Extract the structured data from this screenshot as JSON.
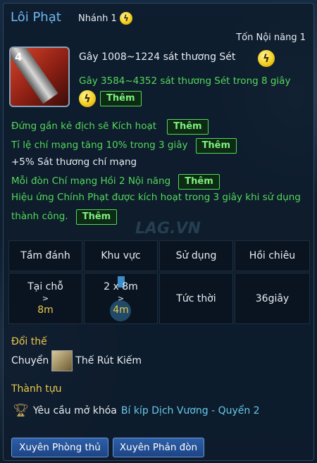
{
  "header": {
    "title": "Lôi Phạt",
    "branch": "Nhánh 1",
    "cost": "Tốn Nội năng 1"
  },
  "skill": {
    "level": "4",
    "damage_line1": "Gây 1008~1224 sát thương Sét",
    "damage_line2": "Gây 3584~4352 sát thương Sét trong 8 giây"
  },
  "effects": {
    "more_label": "Thêm",
    "line1": "Đứng gần kẻ địch sẽ Kích hoạt",
    "line2": "Tỉ lệ chí mạng tăng 10% trong 3 giây",
    "line3": "+5% Sát thương chí mạng",
    "line4": "Mỗi đòn Chí mạng Hồi 2 Nội năng",
    "line5a": "Hiệu ứng Chính Phạt được kích hoạt trong 3 giây khi sử dụng",
    "line5b": "thành công."
  },
  "stats": {
    "headers": [
      "Tầm đánh",
      "Khu vực",
      "Sử dụng",
      "Hồi chiêu"
    ],
    "range_from": "Tại chỗ",
    "range_arrow": ">",
    "range_to": "8m",
    "area_from": "2 x 8m",
    "area_arrow": ">",
    "area_to": "4m",
    "use": "Tức thời",
    "cooldown": "36giây"
  },
  "transform": {
    "heading": "Đổi thế",
    "prefix": "Chuyển",
    "name": "Thế Rút Kiếm"
  },
  "achievement": {
    "heading": "Thành tựu",
    "requirement": "Yêu cầu mở khóa",
    "link": "Bí kíp Dịch Vương - Quyển 2"
  },
  "buttons": {
    "defense": "Xuyên Phòng thủ",
    "counter": "Xuyên Phản đòn"
  },
  "watermark": "LAG.VN",
  "colors": {
    "title": "#6fb7f0",
    "green": "#54d85a",
    "yellow": "#e8c84a",
    "button": "#2d5fa8"
  }
}
